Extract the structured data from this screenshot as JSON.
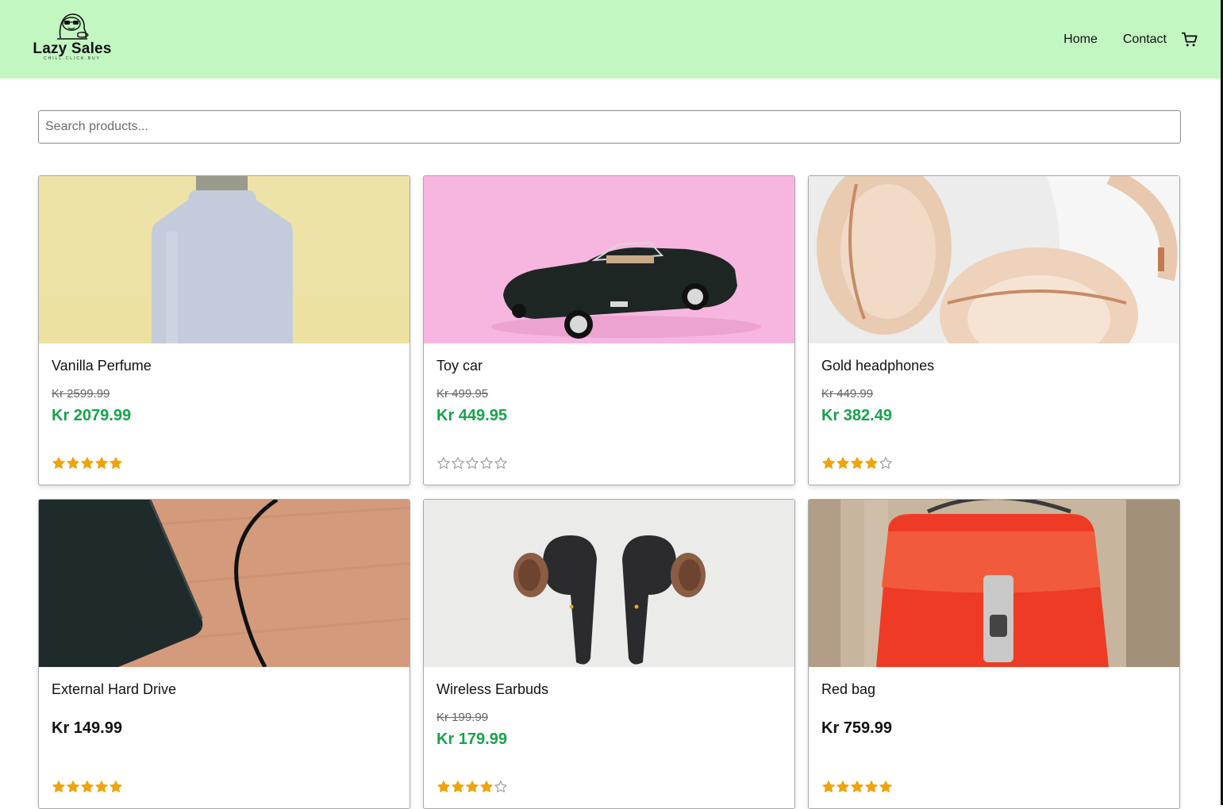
{
  "brand": {
    "name": "Lazy Sales",
    "tagline": "CHILL.CLICK.BUY"
  },
  "nav": {
    "home": "Home",
    "contact": "Contact",
    "cart_icon": "cart-icon"
  },
  "search": {
    "placeholder": "Search products...",
    "value": ""
  },
  "colors": {
    "header": "#c2f7c1",
    "sale_price": "#16a34a",
    "star": "#f0a30a"
  },
  "products": [
    {
      "name": "Vanilla Perfume",
      "old_price": "Kr 2599.99",
      "price": "Kr 2079.99",
      "rating": 5
    },
    {
      "name": "Toy car",
      "old_price": "Kr 499.95",
      "price": "Kr 449.95",
      "rating": 0
    },
    {
      "name": "Gold headphones",
      "old_price": "Kr 449.99",
      "price": "Kr 382.49",
      "rating": 4
    },
    {
      "name": "External Hard Drive",
      "old_price": "",
      "price": "Kr 149.99",
      "rating": 5
    },
    {
      "name": "Wireless Earbuds",
      "old_price": "Kr 199.99",
      "price": "Kr 179.99",
      "rating": 4
    },
    {
      "name": "Red bag",
      "old_price": "",
      "price": "Kr 759.99",
      "rating": 5
    }
  ]
}
